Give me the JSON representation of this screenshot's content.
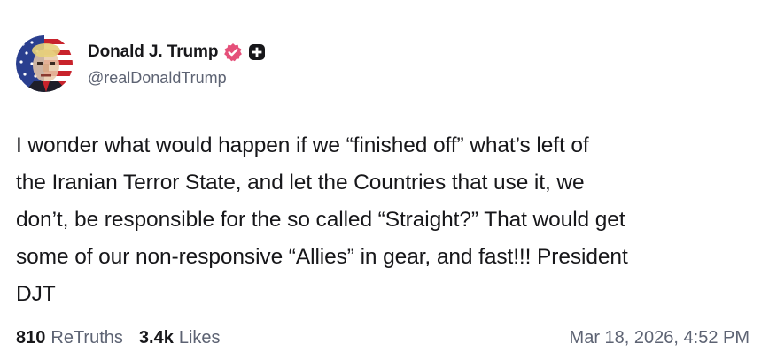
{
  "post": {
    "author": {
      "display_name": "Donald J. Trump",
      "handle": "@realDonaldTrump",
      "avatar_icon": "flag-portrait-avatar",
      "verified_icon": "verified-badge-icon",
      "verified_color": "#e5507a",
      "plus_icon": "plus-badge-icon"
    },
    "text_lines": [
      "I wonder what would happen if we “finished off” what’s left of",
      "the Iranian Terror State, and let the Countries that use it, we",
      "don’t, be responsible for the so called “Straight?” That would get",
      "some of our non-responsive “Allies” in gear, and fast!!! President",
      "DJT"
    ],
    "stats": {
      "retruths_count": "810",
      "retruths_label": "ReTruths",
      "likes_count": "3.4k",
      "likes_label": "Likes"
    },
    "timestamp": "Mar 18, 2026, 4:52 PM"
  },
  "colors": {
    "text_primary": "#17171a",
    "text_secondary": "#5d6373",
    "background": "#ffffff"
  }
}
